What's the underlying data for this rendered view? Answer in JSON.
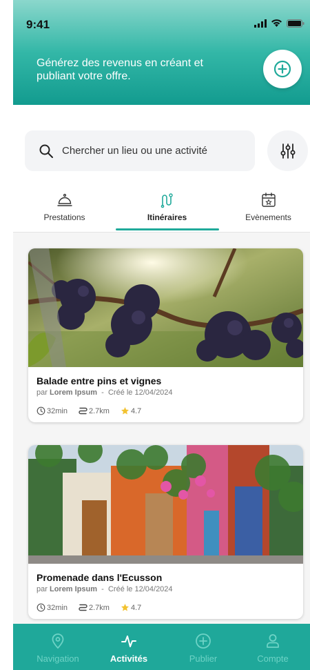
{
  "status_bar": {
    "time": "9:41"
  },
  "header": {
    "promo_text": "Générez des revenus en créant et publiant votre offre.",
    "colors": {
      "accent": "#1fa99a"
    }
  },
  "search": {
    "placeholder": "Chercher un lieu ou une activité"
  },
  "tabs": [
    {
      "label": "Prestations",
      "icon": "service-bell-icon"
    },
    {
      "label": "Itinéraires",
      "icon": "route-icon",
      "active": true
    },
    {
      "label": "Evènements",
      "icon": "calendar-star-icon"
    }
  ],
  "cards": [
    {
      "title": "Balade entre pins et vignes",
      "by": "par",
      "author": "Lorem Ipsum",
      "separator": "-",
      "created": "Créé le 12/04/2024",
      "duration": "32min",
      "distance": "2.7km",
      "rating": "4.7",
      "image": "grapes-vineyard-photo"
    },
    {
      "title": "Promenade dans l'Ecusson",
      "by": "par",
      "author": "Lorem Ipsum",
      "separator": "-",
      "created": "Créé le 12/04/2024",
      "duration": "32min",
      "distance": "2.7km",
      "rating": "4.7",
      "image": "colorful-street-photo"
    }
  ],
  "bottom_nav": [
    {
      "label": "Navigation",
      "icon": "location-pin-icon"
    },
    {
      "label": "Activités",
      "icon": "activity-pulse-icon",
      "active": true
    },
    {
      "label": "Publier",
      "icon": "plus-circle-icon"
    },
    {
      "label": "Compte",
      "icon": "user-icon"
    }
  ]
}
